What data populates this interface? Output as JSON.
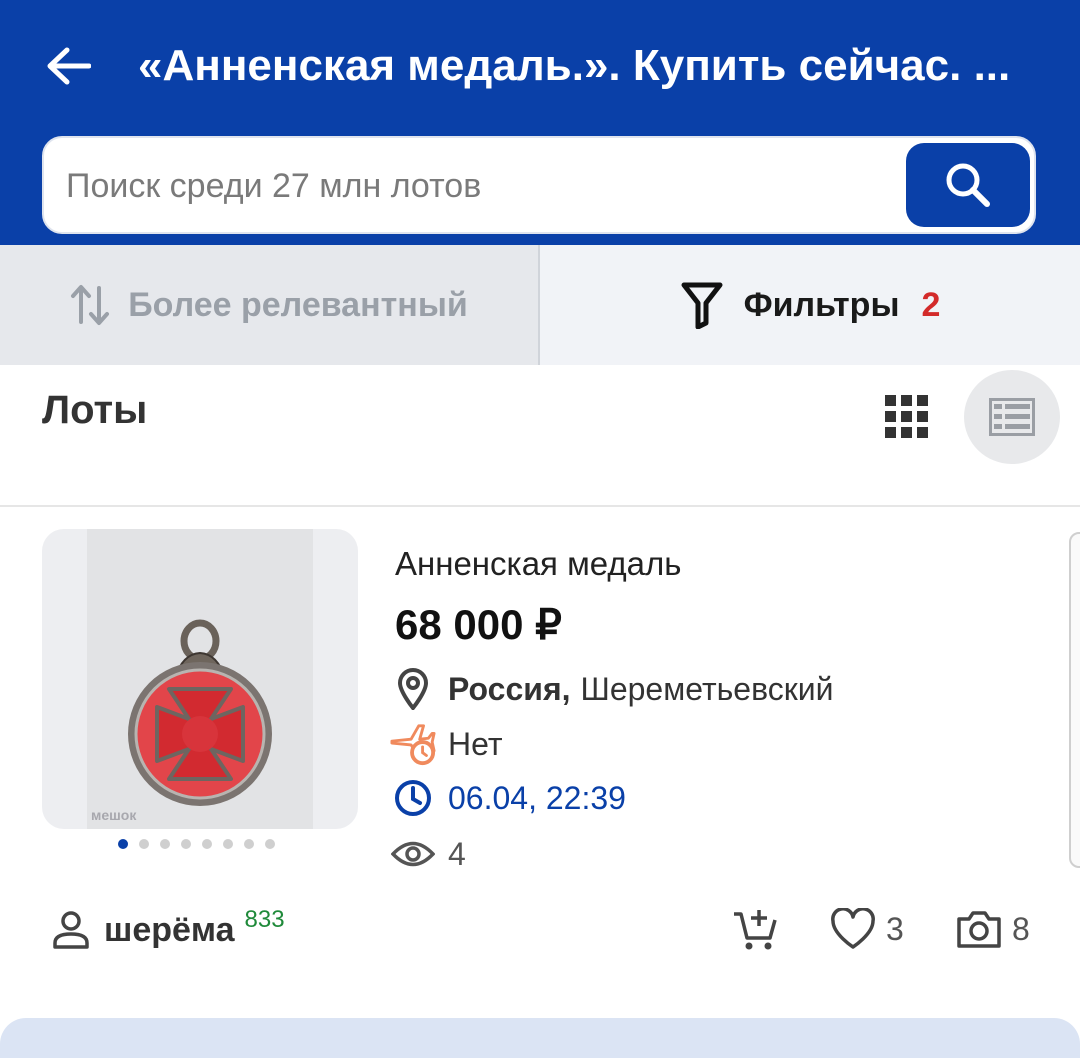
{
  "header": {
    "title": "«Анненская медаль.». Купить сейчас. ...",
    "search_placeholder": "Поиск среди 27 млн лотов"
  },
  "toolbar": {
    "sort_label": "Более релевантный",
    "filter_label": "Фильтры",
    "filter_count": "2"
  },
  "lots": {
    "title": "Лоты"
  },
  "item": {
    "title": "Анненская медаль",
    "price": "68 000 ₽",
    "location_country": "Россия,",
    "location_city": "Шереметьевский",
    "shipping": "Нет",
    "end_time": "06.04, 22:39",
    "views": "4",
    "image_watermark": "мешок",
    "image_count_dots": 8,
    "image_active_dot": 1,
    "seller_name": "шерёма",
    "seller_rating": "833",
    "favorites": "3",
    "photos": "8"
  },
  "colors": {
    "brand_blue": "#0a40a8",
    "filter_badge_red": "#d32a2a",
    "rating_green": "#1f8a3a",
    "shipping_icon_orange": "#f08a5d"
  }
}
